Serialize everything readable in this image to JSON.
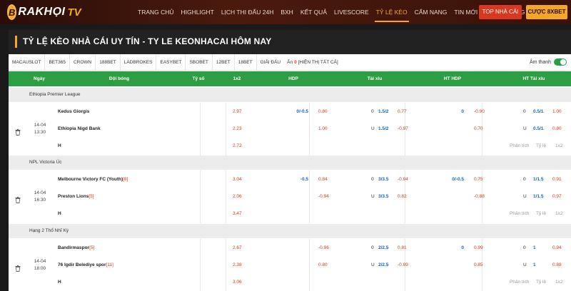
{
  "brand": {
    "logo_initial": "B",
    "logo_text": "RAKHỌI",
    "logo_suffix": "TV"
  },
  "nav": {
    "items": [
      "TRANG CHỦ",
      "HIGHLIGHT",
      "LỊCH THI ĐẤU 24H",
      "BXH",
      "KẾT QUẢ",
      "LIVESCORE",
      "TỶ LỆ KÈO",
      "CẨM NANG",
      "TIN MỚI",
      "TUYỂN DỤNG"
    ],
    "active_index": 6,
    "top_button": "TOP NHÀ CÁI",
    "bet_button": "CƯỢC 8XBET"
  },
  "page": {
    "title": "TỶ LỆ KÈO NHÀ CÁI UY TÍN - TY LE KEONHACAI HÔM NAY"
  },
  "bookmakers": {
    "items": [
      "MACAUSLOT",
      "BET365",
      "CROWN",
      "188BET",
      "LADBROKES",
      "EASYBET",
      "SBOBET",
      "12BET",
      "18BET",
      "GIẢI ĐẤU"
    ],
    "hidden_label": "Ẩn",
    "hidden_count": "0",
    "show_all": "[HIỆN THỊ TẤT CẢ]",
    "sound_label": "Âm thanh"
  },
  "table": {
    "headers": {
      "date": "Ngày",
      "teams": "Đội bóng",
      "score": "Tỷ số",
      "odds1x2": "1x2",
      "hdp": "HDP",
      "ou": "Tài xỉu",
      "ht_hdp": "HT HDP",
      "ht_ou": "HT Tài xỉu"
    },
    "links": {
      "analysis": "Phân tích",
      "history": "Tỷ lệ",
      "x12": "1x2"
    }
  },
  "matches": [
    {
      "league": "Ethiopia Premier League",
      "date": "14-04",
      "time": "13:30",
      "home": "Kedus Giorgis",
      "home_rank": "",
      "away": "Ethiopia Nigd Bank",
      "away_rank": "",
      "draw_label": "H",
      "x12": [
        "2.97",
        "2.23",
        "2.72"
      ],
      "hdp_line": "0/-0.5",
      "hdp_home": "0.80",
      "hdp_away": "1.00",
      "ou_o_label": "0",
      "ou_line1": "1.5/2",
      "ou_o": "0.77",
      "ou_u_label": "U",
      "ou_line2": "1.5/2",
      "ou_u": "-0.97",
      "hthdp_line": "0",
      "hthdp_home": "-0.90",
      "hthdp_away": "0.70",
      "htou_o_label": "0",
      "htou_line1": "0.5/1",
      "htou_o": "1.00",
      "htou_u_label": "U",
      "htou_line2": "0.5/1",
      "htou_u": "0.80"
    },
    {
      "league": "NPL Victoria Úc",
      "date": "14-04",
      "time": "16:30",
      "home": "Melbourne Victory FC (Youth)",
      "home_rank": "[8]",
      "away": "Preston Lions",
      "away_rank": "[5]",
      "draw_label": "H",
      "x12": [
        "3.04",
        "2.06",
        "3.47"
      ],
      "hdp_line": "-0.5",
      "hdp_home": "0.84",
      "hdp_away": "-0.94",
      "ou_o_label": "0",
      "ou_line1": "3/3.5",
      "ou_o": "-0.94",
      "ou_u_label": "U",
      "ou_line2": "3/3.5",
      "ou_u": "0.82",
      "hthdp_line": "0/-0.5",
      "hthdp_home": "0.75",
      "hthdp_away": "-0.88",
      "htou_o_label": "0",
      "htou_line1": "1/1.5",
      "htou_o": "0.91",
      "htou_u_label": "U",
      "htou_line2": "1/1.5",
      "htou_u": "0.97"
    },
    {
      "league": "Hạng 2 Thổ Nhĩ Kỳ",
      "date": "14-04",
      "time": "18:00",
      "home": "Bandirmaspor",
      "home_rank": "[5]",
      "away": "76 Igdir Belediye spor",
      "away_rank": "[11]",
      "draw_label": "H",
      "x12": [
        "2.67",
        "2.38",
        "3.06"
      ],
      "hdp_line": "",
      "hdp_home": "-0.96",
      "hdp_away": "0.80",
      "ou_o_label": "0",
      "ou_line1": "2/2.5",
      "ou_o": "0.81",
      "ou_u_label": "U",
      "ou_line2": "2/2.5",
      "ou_u": "-0.99",
      "hthdp_line": "0",
      "hthdp_home": "0.99",
      "hthdp_away": "0.85",
      "htou_o_label": "0",
      "htou_line1": "1",
      "htou_o": "0.94",
      "htou_u_label": "U",
      "htou_line2": "1",
      "htou_u": "0.88"
    }
  ],
  "colors": {
    "accent": "#f5a623",
    "header_green": "#2e9e44",
    "odds_red": "#d9381e",
    "line_blue": "#1565c0"
  }
}
